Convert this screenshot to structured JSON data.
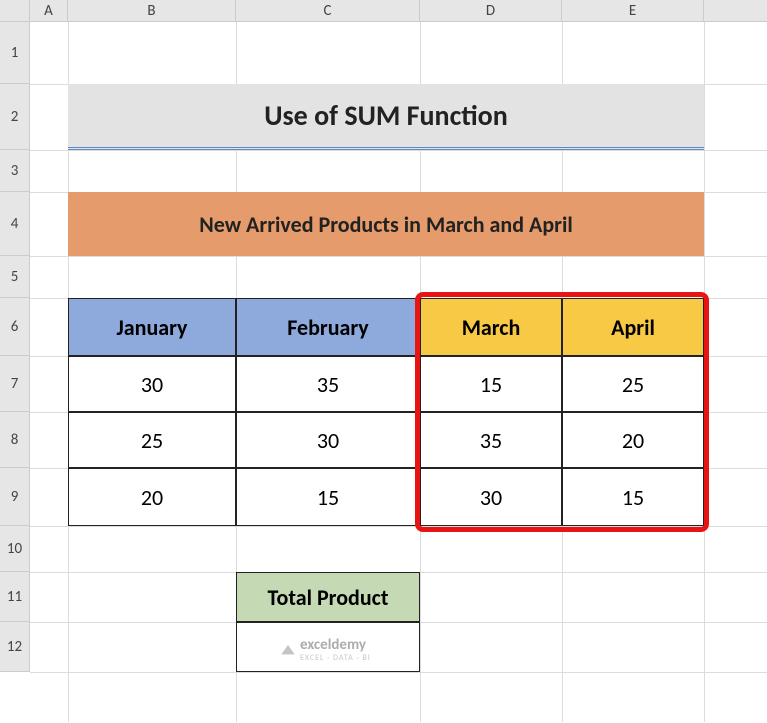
{
  "columns": [
    "A",
    "B",
    "C",
    "D",
    "E"
  ],
  "rows": [
    "1",
    "2",
    "3",
    "4",
    "5",
    "6",
    "7",
    "8",
    "9",
    "10",
    "11",
    "12"
  ],
  "title": "Use of SUM Function",
  "subtitle": "New Arrived Products in March and April",
  "table": {
    "headers": [
      "January",
      "February",
      "March",
      "April"
    ],
    "data": [
      [
        "30",
        "35",
        "15",
        "25"
      ],
      [
        "25",
        "30",
        "35",
        "20"
      ],
      [
        "20",
        "15",
        "30",
        "15"
      ]
    ]
  },
  "total": {
    "label": "Total Product",
    "value": ""
  },
  "watermark": {
    "brand": "exceldemy",
    "tagline": "EXCEL · DATA · BI"
  },
  "chart_data": {
    "type": "table",
    "title": "Use of SUM Function",
    "categories": [
      "January",
      "February",
      "March",
      "April"
    ],
    "series": [
      {
        "name": "Row 7",
        "values": [
          30,
          35,
          15,
          25
        ]
      },
      {
        "name": "Row 8",
        "values": [
          25,
          30,
          35,
          20
        ]
      },
      {
        "name": "Row 9",
        "values": [
          20,
          15,
          30,
          15
        ]
      }
    ]
  }
}
